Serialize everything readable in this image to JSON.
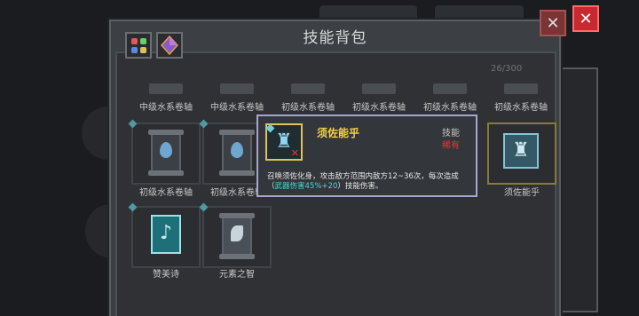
{
  "window": {
    "title": "技能背包",
    "count": "26/300"
  },
  "tabs": [
    {
      "name": "all-items",
      "active": true
    },
    {
      "name": "gems",
      "active": false
    }
  ],
  "items": {
    "row0": [
      "中级水系卷轴",
      "中级水系卷轴",
      "初级水系卷轴",
      "初级水系卷轴",
      "初级水系卷轴",
      "初级水系卷轴"
    ],
    "row1": [
      "初级水系卷轴",
      "初级水系卷轴",
      "须佐能乎"
    ],
    "row2": [
      "赞美诗",
      "元素之智"
    ]
  },
  "tooltip": {
    "name": "须佐能乎",
    "type": "技能",
    "rarity": "稀有",
    "desc_pre": "召唤须佐化身，攻击敌方范围内敌方12~36次，每次造成（",
    "desc_hl": "武器伤害45%+20",
    "desc_post": "）技能伤害。"
  },
  "colors": {
    "accent_close": "#c8292e",
    "item_name": "#f2d24a",
    "rarity": "#e23a3a",
    "highlight": "#4fd6d6"
  }
}
